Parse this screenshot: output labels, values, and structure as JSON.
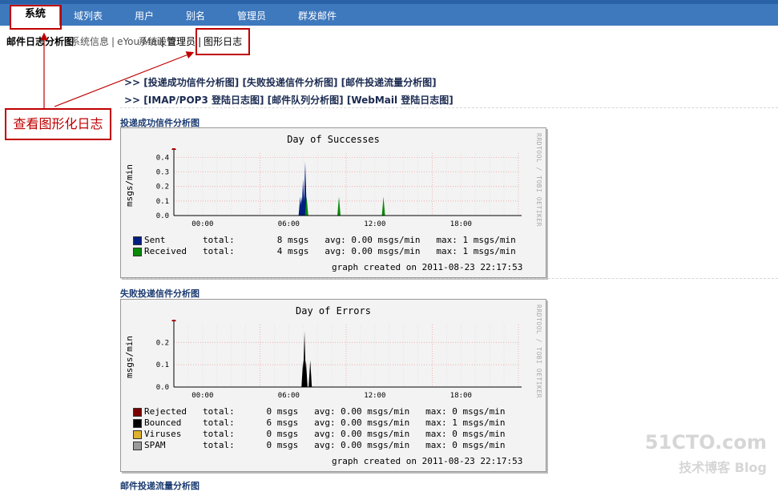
{
  "nav": {
    "tabs": [
      {
        "label": "系统"
      },
      {
        "label": "域列表"
      },
      {
        "label": "用户"
      },
      {
        "label": "别名"
      },
      {
        "label": "管理员"
      },
      {
        "label": "群发邮件"
      }
    ]
  },
  "subnav": {
    "current": "邮件日志分析图",
    "overlap_1": "系统信息",
    "overlap_2": "eYou Mail",
    "overlap_3": "系统设置",
    "items": [
      "管理员",
      "图形日志"
    ]
  },
  "annotation": {
    "text": "查看图形化日志"
  },
  "links": {
    "row1": [
      "投递成功信件分析图",
      "失败投递信件分析图",
      "邮件投递流量分析图"
    ],
    "row2": [
      "IMAP/POP3 登陆日志图",
      "邮件队列分析图",
      "WebMail 登陆日志图"
    ],
    "prefix": ">>"
  },
  "sections": {
    "success_title": "投递成功信件分析图",
    "errors_title": "失败投递信件分析图",
    "traffic_title": "邮件投递流量分析图"
  },
  "colors": {
    "sent": "#001e80",
    "received": "#0a8a0a",
    "rejected": "#7a0000",
    "bounced": "#000000",
    "viruses": "#e0b030",
    "spam": "#9a9a9a",
    "annotation": "#c00000"
  },
  "chart_data": [
    {
      "type": "area",
      "title": "Day of Successes",
      "ylabel": "msgs/min",
      "xticks": [
        "00:00",
        "06:00",
        "12:00",
        "18:00"
      ],
      "yticks": [
        "0.4",
        "0.3",
        "0.2",
        "0.1",
        "0.0"
      ],
      "ylim": [
        0,
        0.43
      ],
      "series": [
        {
          "name": "Sent",
          "color": "#001e80",
          "points": [
            [
              8.8,
              0.13
            ],
            [
              8.9,
              0.13
            ],
            [
              9.0,
              0.25
            ],
            [
              9.15,
              0.37
            ]
          ],
          "stats": "total:        8 msgs   avg: 0.00 msgs/min   max: 1 msgs/min"
        },
        {
          "name": "Received",
          "color": "#0a8a0a",
          "points": [
            [
              9.25,
              0.13
            ],
            [
              11.5,
              0.13
            ],
            [
              14.6,
              0.13
            ]
          ],
          "stats": "total:        4 msgs   avg: 0.00 msgs/min   max: 1 msgs/min"
        }
      ],
      "footer": "graph created on 2011-08-23 22:17:53",
      "side": "RRDTOOL / TOBI OETIKER"
    },
    {
      "type": "area",
      "title": "Day of Errors",
      "ylabel": "msgs/min",
      "xticks": [
        "00:00",
        "06:00",
        "12:00",
        "18:00"
      ],
      "yticks": [
        "0.2",
        "0.1",
        "0.0"
      ],
      "ylim": [
        0,
        0.28
      ],
      "series": [
        {
          "name": "Rejected",
          "color": "#7a0000",
          "points": [],
          "stats": "total:      0 msgs   avg: 0.00 msgs/min   max: 0 msgs/min"
        },
        {
          "name": "Bounced",
          "color": "#000000",
          "points": [
            [
              9.0,
              0.12
            ],
            [
              9.1,
              0.25
            ],
            [
              9.2,
              0.12
            ],
            [
              9.5,
              0.12
            ]
          ],
          "stats": "total:      6 msgs   avg: 0.00 msgs/min   max: 1 msgs/min"
        },
        {
          "name": "Viruses",
          "color": "#e0b030",
          "points": [],
          "stats": "total:      0 msgs   avg: 0.00 msgs/min   max: 0 msgs/min"
        },
        {
          "name": "SPAM",
          "color": "#9a9a9a",
          "points": [],
          "stats": "total:      0 msgs   avg: 0.00 msgs/min   max: 0 msgs/min"
        }
      ],
      "footer": "graph created on 2011-08-23 22:17:53",
      "side": "RRDTOOL / TOBI OETIKER"
    }
  ],
  "watermark": {
    "line1": "51CTO.com",
    "line2": "技术博客  Blog"
  }
}
